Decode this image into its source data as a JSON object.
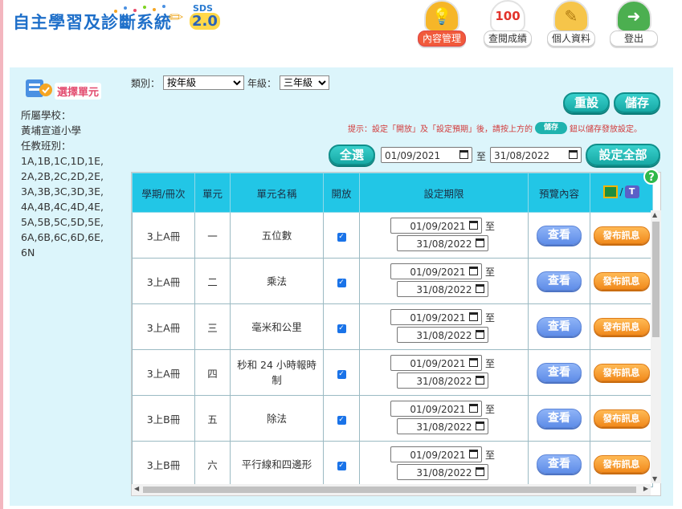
{
  "header": {
    "logo_text": "自主學習及診斷系統",
    "logo_sds": "SDS",
    "logo_version": "2.0",
    "nav": [
      {
        "label": "內容管理",
        "icon": "lightbulb-icon",
        "active": true
      },
      {
        "label": "查閱成績",
        "icon": "score-100-icon",
        "active": false
      },
      {
        "label": "個人資料",
        "icon": "notepad-icon",
        "active": false
      },
      {
        "label": "登出",
        "icon": "exit-door-icon",
        "active": false
      }
    ]
  },
  "sidebar": {
    "title": "選擇單元",
    "school_label": "所屬學校：",
    "school_name": "黃埔宣道小學",
    "classes_label": "任教班別：",
    "classes": "1A,1B,1C,1D,1E,2A,2B,2C,2D,2E,3A,3B,3C,3D,3E,4A,4B,4C,4D,4E,5A,5B,5C,5D,5E,6A,6B,6C,6D,6E,6N"
  },
  "filters": {
    "category_label": "類別：",
    "category_value": "按年級",
    "grade_label": "年級：",
    "grade_value": "三年級"
  },
  "actions": {
    "reset": "重設",
    "save": "儲存",
    "hint_prefix": "提示：設定「開放」及「設定預期」後，請按上方的",
    "hint_button": "儲存",
    "hint_suffix": "鈕以儲存發放設定。",
    "select_all": "全選",
    "range_start": "01/09/2021",
    "range_to": "至",
    "range_end": "31/08/2022",
    "set_all": "設定全部",
    "help": "?"
  },
  "table": {
    "headers": [
      "學期/冊次",
      "單元",
      "單元名稱",
      "開放",
      "設定期限",
      "預覽內容",
      "/"
    ],
    "view_label": "查看",
    "publish_label": "發布訊息",
    "to_label": "至",
    "rows": [
      {
        "book": "3上A冊",
        "unit": "一",
        "name": "五位數",
        "open": true,
        "start": "01/09/2021",
        "end": "31/08/2022"
      },
      {
        "book": "3上A冊",
        "unit": "二",
        "name": "乘法",
        "open": true,
        "start": "01/09/2021",
        "end": "31/08/2022"
      },
      {
        "book": "3上A冊",
        "unit": "三",
        "name": "毫米和公里",
        "open": true,
        "start": "01/09/2021",
        "end": "31/08/2022"
      },
      {
        "book": "3上A冊",
        "unit": "四",
        "name": "秒和 24 小時報時制",
        "open": true,
        "start": "01/09/2021",
        "end": "31/08/2022"
      },
      {
        "book": "3上B冊",
        "unit": "五",
        "name": "除法",
        "open": true,
        "start": "01/09/2021",
        "end": "31/08/2022"
      },
      {
        "book": "3上B冊",
        "unit": "六",
        "name": "平行線和四邊形",
        "open": true,
        "start": "01/09/2021",
        "end": "31/08/2022"
      }
    ]
  },
  "colors": {
    "teal_button": "#1fb3ae",
    "header_cyan": "#22c6e6",
    "panel_bg": "#dcf5fb",
    "hint_red": "#d23a3a",
    "view_blue": "#6f9cf0",
    "publish_orange": "#f39a2a"
  }
}
